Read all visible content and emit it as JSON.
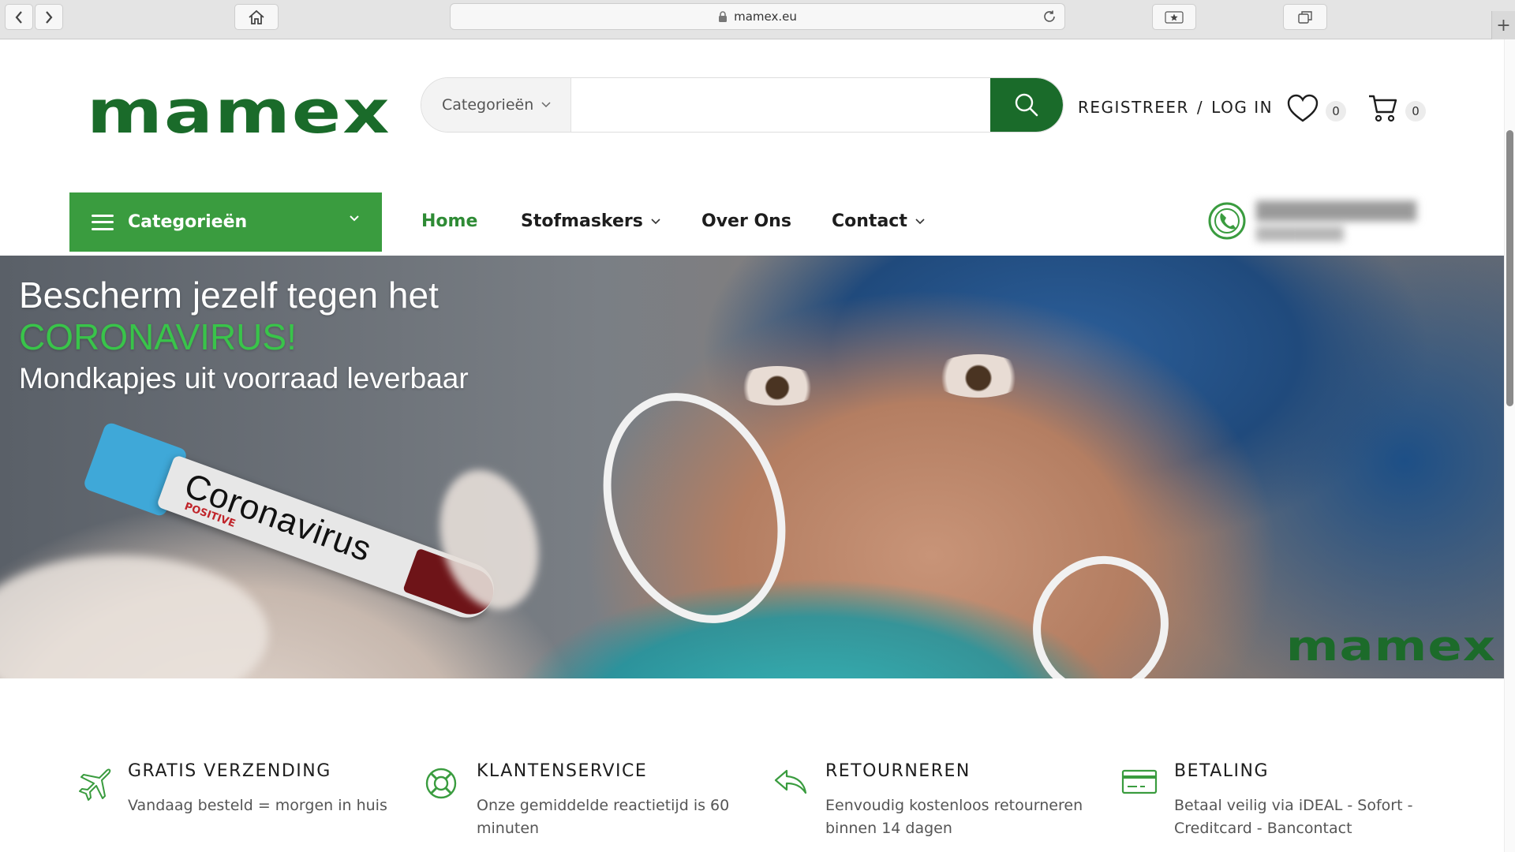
{
  "browser": {
    "url": "mamex.eu"
  },
  "header": {
    "logo": "mamex",
    "search": {
      "category_label": "Categorieën",
      "placeholder": ""
    },
    "register_label": "REGISTREER",
    "separator": "/",
    "login_label": "LOG IN",
    "wishlist_count": "0",
    "cart_count": "0"
  },
  "nav": {
    "categories_label": "Categorieën",
    "links": [
      {
        "label": "Home",
        "active": true
      },
      {
        "label": "Stofmaskers"
      },
      {
        "label": "Over Ons"
      },
      {
        "label": "Contact"
      }
    ]
  },
  "hero": {
    "line1": "Bescherm jezelf tegen het",
    "line2": "CORONAVIRUS!",
    "line3": "Mondkapjes uit voorraad leverbaar",
    "tube_label": "Coronavirus",
    "tube_sublabel": "POSITIVE",
    "watermark": "mamex"
  },
  "features": [
    {
      "title": "GRATIS VERZENDING",
      "desc": "Vandaag besteld = morgen in huis",
      "icon": "airplane-icon"
    },
    {
      "title": "KLANTENSERVICE",
      "desc": "Onze gemiddelde reactietijd is 60 minuten",
      "icon": "lifebuoy-icon"
    },
    {
      "title": "RETOURNEREN",
      "desc": "Eenvoudig kostenloos retourneren binnen 14 dagen",
      "icon": "return-arrow-icon"
    },
    {
      "title": "BETALING",
      "desc": "Betaal veilig via iDEAL - Sofort - Creditcard - Bancontact",
      "icon": "credit-card-icon"
    }
  ],
  "colors": {
    "brand_dark_green": "#1a6b2a",
    "brand_green": "#3a9c3f",
    "hero_green_text": "#39c44a"
  }
}
